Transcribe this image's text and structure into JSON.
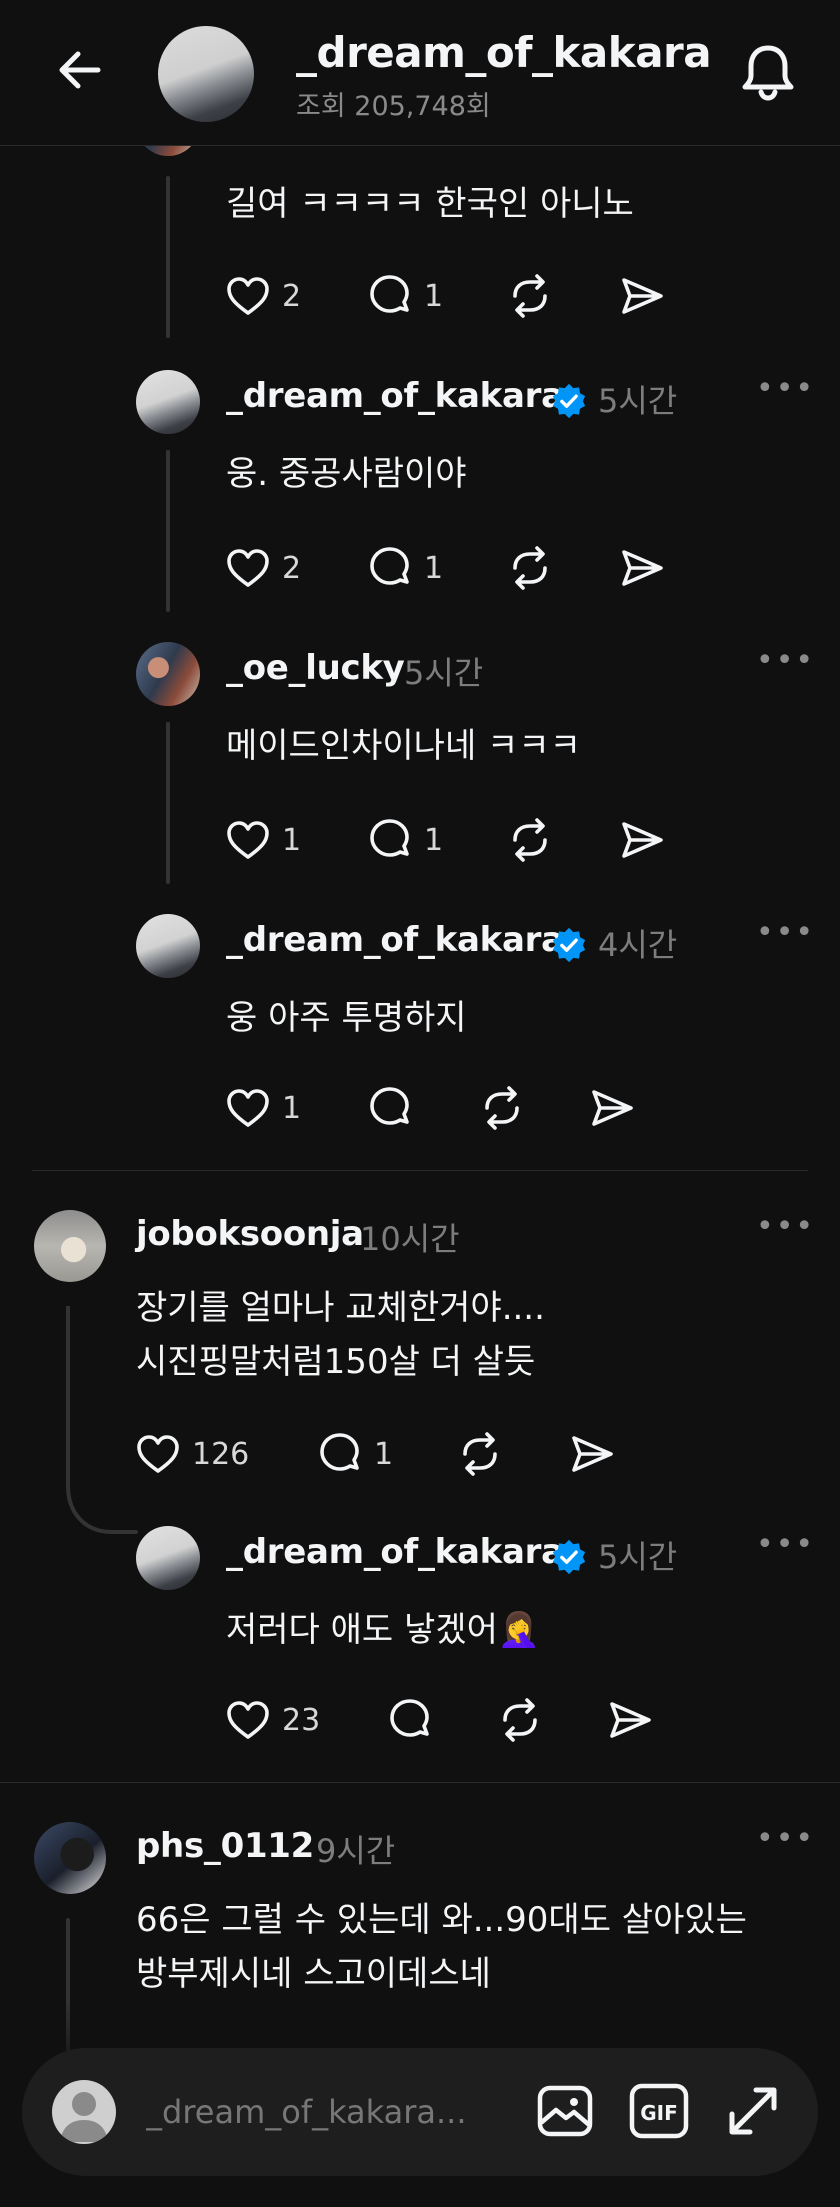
{
  "header": {
    "title": "_dream_of_kakara",
    "views": "조회 205,748회"
  },
  "comments": [
    {
      "text": "길여 ㅋㅋㅋㅋ 한국인 아니노",
      "likes": "2",
      "replies": "1"
    },
    {
      "username": "_dream_of_kakara",
      "verified": true,
      "time": "5시간",
      "text": "웅. 중공사람이야",
      "likes": "2",
      "replies": "1"
    },
    {
      "username": "_oe_lucky",
      "time": "5시간",
      "text": "메이드인차이나네 ㅋㅋㅋ",
      "likes": "1",
      "replies": "1"
    },
    {
      "username": "_dream_of_kakara",
      "verified": true,
      "time": "4시간",
      "text": "웅 아주 투명하지",
      "likes": "1",
      "replies": ""
    },
    {
      "username": "joboksoonja",
      "time": "10시간",
      "text_line1": "장기를 얼마나 교체한거야....",
      "text_line2": "시진핑말처럼150살 더 살듯",
      "likes": "126",
      "replies": "1"
    },
    {
      "username": "_dream_of_kakara",
      "verified": true,
      "time": "5시간",
      "text": "저러다 애도 낳겠어🤦‍♀️",
      "likes": "23",
      "replies": ""
    },
    {
      "username": "phs_0112",
      "time": "9시간",
      "text_line1": "66은 그럴 수 있는데 와...90대도 살아있는",
      "text_line2": "방부제시네 스고이데스네"
    }
  ],
  "composer": {
    "placeholder": "_dream_of_kakara..."
  },
  "colors": {
    "background": "#101010",
    "text": "#f3f5f7",
    "muted": "#7d7d7d",
    "verified": "#0095f6",
    "composer_bg": "#1e1e1e"
  },
  "icons": {
    "back": "arrow-left-icon",
    "bell": "bell-icon",
    "like": "heart-icon",
    "reply": "comment-bubble-icon",
    "repost": "repost-icon",
    "share": "send-icon",
    "image": "image-icon",
    "gif": "gif-icon",
    "expand": "expand-icon"
  }
}
